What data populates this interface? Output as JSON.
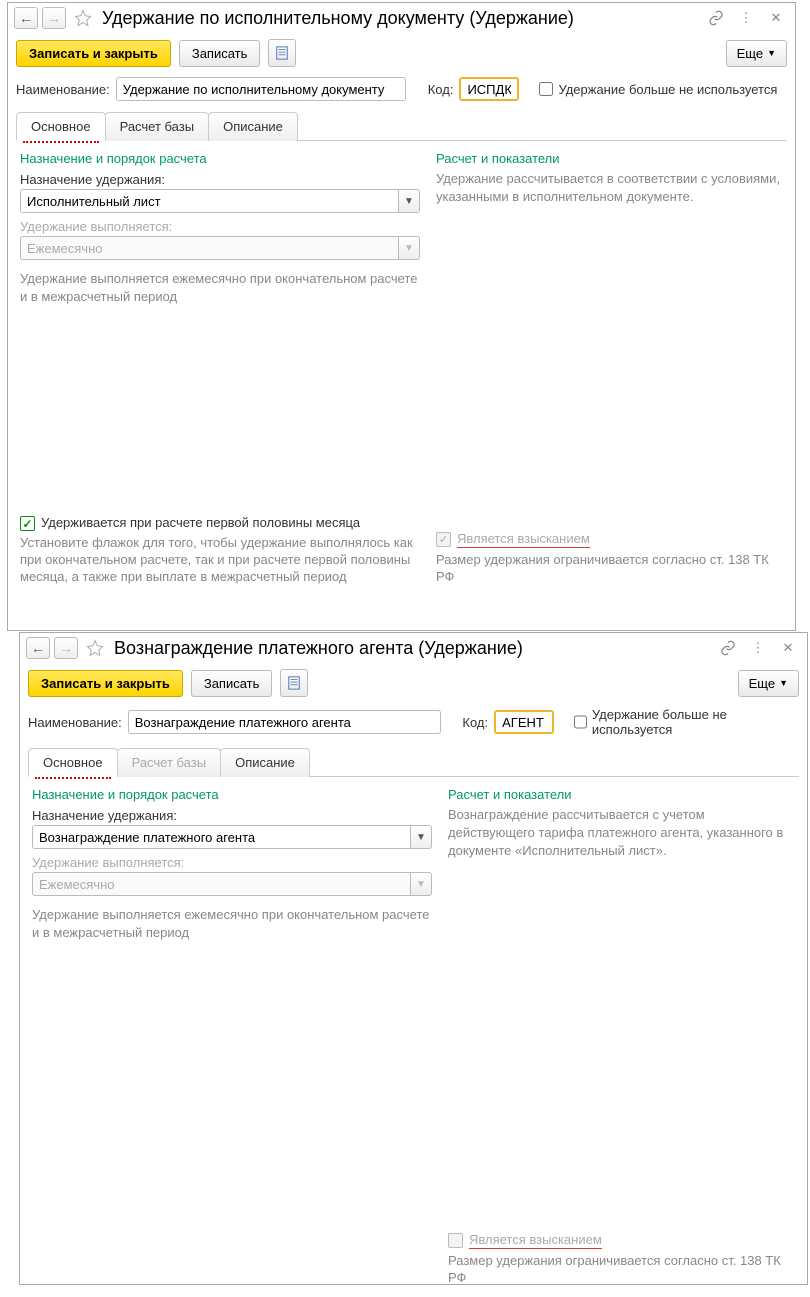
{
  "window1": {
    "title": "Удержание по исполнительному документу (Удержание)",
    "toolbar": {
      "save_close": "Записать и закрыть",
      "save": "Записать",
      "more": "Еще"
    },
    "name_label": "Наименование:",
    "name_value": "Удержание по исполнительному документу",
    "code_label": "Код:",
    "code_value": "ИСПДК",
    "not_used_label": "Удержание больше не используется",
    "tabs": {
      "main": "Основное",
      "base": "Расчет базы",
      "desc": "Описание"
    },
    "left": {
      "section": "Назначение и порядок расчета",
      "purpose_label": "Назначение удержания:",
      "purpose_value": "Исполнительный лист",
      "perform_label": "Удержание выполняется:",
      "perform_value": "Ежемесячно",
      "perform_note1": "Удержание выполняется ежемесячно при окончательном расчете",
      "perform_note2": "и в межрасчетный период",
      "first_half_label": "Удерживается при расчете первой половины месяца",
      "first_half_hint": "Установите флажок для того, чтобы удержание выполнялось как при окончательном расчете, так и при расчете первой половины месяца, а также при выплате в межрасчетный период"
    },
    "right": {
      "section": "Расчет и показатели",
      "info": "Удержание рассчитывается в соответствии с условиями, указанными в исполнительном документе.",
      "is_levy": "Является взысканием",
      "limit": "Размер удержания ограничивается согласно ст. 138 ТК РФ"
    }
  },
  "window2": {
    "title": "Вознаграждение платежного агента (Удержание)",
    "toolbar": {
      "save_close": "Записать и закрыть",
      "save": "Записать",
      "more": "Еще"
    },
    "name_label": "Наименование:",
    "name_value": "Вознаграждение платежного агента",
    "code_label": "Код:",
    "code_value": "АГЕНТ",
    "not_used_label": "Удержание больше не используется",
    "tabs": {
      "main": "Основное",
      "base": "Расчет базы",
      "desc": "Описание"
    },
    "left": {
      "section": "Назначение и порядок расчета",
      "purpose_label": "Назначение удержания:",
      "purpose_value": "Вознаграждение платежного агента",
      "perform_label": "Удержание выполняется:",
      "perform_value": "Ежемесячно",
      "perform_note1": "Удержание выполняется ежемесячно при окончательном расчете",
      "perform_note2": "и в межрасчетный период"
    },
    "right": {
      "section": "Расчет и показатели",
      "info": "Вознаграждение рассчитывается с учетом действующего тарифа платежного агента, указанного в документе «Исполнительный лист».",
      "is_levy": "Является взысканием",
      "limit": "Размер удержания ограничивается согласно ст. 138 ТК РФ"
    }
  }
}
